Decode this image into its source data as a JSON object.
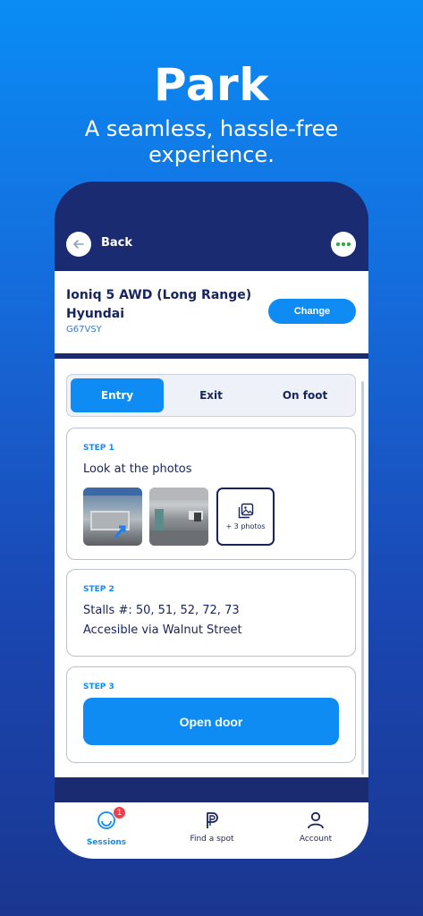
{
  "hero": {
    "title": "Park",
    "subtitle": "A seamless, hassle-free experience."
  },
  "header": {
    "back_label": "Back",
    "back_icon": "arrow-left-icon",
    "more_icon": "more-horizontal-icon"
  },
  "vehicle": {
    "name": "Ioniq 5 AWD (Long Range) Hyundai",
    "plate": "G67VSY",
    "change_label": "Change"
  },
  "tabs": [
    {
      "label": "Entry",
      "active": true
    },
    {
      "label": "Exit",
      "active": false
    },
    {
      "label": "On foot",
      "active": false
    }
  ],
  "steps": {
    "step1": {
      "label": "STEP 1",
      "title": "Look at the photos",
      "more_photos_label": "+ 3 photos",
      "more_photos_icon": "photo-gallery-icon"
    },
    "step2": {
      "label": "STEP 2",
      "line1": "Stalls #: 50, 51, 52, 72, 73",
      "line2": "Accesible via Walnut Street"
    },
    "step3": {
      "label": "STEP 3",
      "button_label": "Open door"
    }
  },
  "bottom_nav": [
    {
      "label": "Sessions",
      "icon": "sessions-icon",
      "badge": "1",
      "active": true
    },
    {
      "label": "Find a spot",
      "icon": "parking-icon",
      "active": false
    },
    {
      "label": "Account",
      "icon": "user-icon",
      "active": false
    }
  ],
  "colors": {
    "accent": "#0f8cf4",
    "navy": "#17245e",
    "badge": "#f23d4f"
  }
}
